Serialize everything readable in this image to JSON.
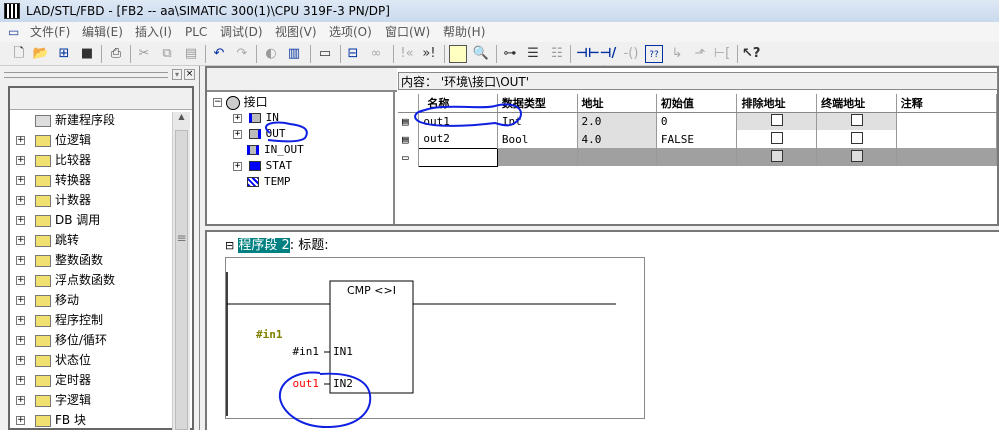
{
  "window": {
    "title": "LAD/STL/FBD  - [FB2 -- aa\\SIMATIC 300(1)\\CPU 319F-3 PN/DP]"
  },
  "menu": [
    "文件(F)",
    "编辑(E)",
    "插入(I)",
    "PLC",
    "调试(D)",
    "视图(V)",
    "选项(O)",
    "窗口(W)",
    "帮助(H)"
  ],
  "toolbar_icons": [
    "new-icon",
    "open-icon",
    "accessible-nodes-icon",
    "save-icon",
    "print-icon",
    "cut-icon",
    "copy-icon",
    "paste-icon",
    "undo-icon",
    "redo-icon",
    "monitor-icon",
    "download-icon",
    "address-icon",
    "network-icon",
    "glasses-icon",
    "prev-error-icon",
    "next-error-icon",
    "overview-icon",
    "details-icon",
    "new-network-icon",
    "tree-icon",
    "tree2-icon",
    "contact-no-icon",
    "contact-nc-icon",
    "coil-icon",
    "box-icon",
    "branch-open-icon",
    "branch-close-icon",
    "connection-icon",
    "help-icon"
  ],
  "catalog": {
    "items": [
      "新建程序段",
      "位逻辑",
      "比较器",
      "转换器",
      "计数器",
      "DB 调用",
      "跳转",
      "整数函数",
      "浮点数函数",
      "移动",
      "程序控制",
      "移位/循环",
      "状态位",
      "定时器",
      "字逻辑",
      "FB 块"
    ]
  },
  "interface_tree": {
    "root": "接口",
    "items": [
      "IN",
      "OUT",
      "IN_OUT",
      "STAT",
      "TEMP"
    ]
  },
  "table": {
    "content_path": "内容： '环境\\接口\\OUT'",
    "columns": [
      "名称",
      "数据类型",
      "地址",
      "初始值",
      "排除地址",
      "终端地址",
      "注释"
    ],
    "rows": [
      {
        "name": "out1",
        "type": "Int",
        "address": "2.0",
        "initial": "0"
      },
      {
        "name": "out2",
        "type": "Bool",
        "address": "4.0",
        "initial": "FALSE"
      }
    ]
  },
  "network": {
    "label": "程序段 2",
    "title_label": ": 标题:",
    "block": "CMP <>I",
    "in1_pin": "IN1",
    "in2_pin": "IN2",
    "in1_operand": "#in1",
    "in2_operand": "out1",
    "comment_operand": "#in1"
  },
  "colors": {
    "annotation": "#1020e0",
    "error_operand": "#ff0000",
    "network_highlight": "#008080",
    "symbol_olive": "#808000"
  }
}
